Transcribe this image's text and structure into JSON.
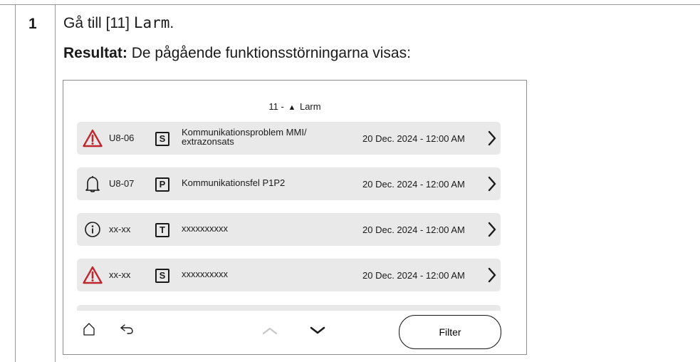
{
  "step": {
    "number": "1",
    "instruction_prefix": "Gå till [11] ",
    "instruction_code": "Larm",
    "instruction_suffix": ".",
    "result_label": "Resultat:",
    "result_text": " De pågående funktionsstörningarna visas:"
  },
  "screen": {
    "title_prefix": "11 - ",
    "title_icon": "warning-triangle-icon",
    "title_text": "Larm",
    "rows": [
      {
        "icon": "warning-triangle-icon",
        "code": "U8-06",
        "badge": "S",
        "desc": "Kommunikationsproblem MMI/ extrazonsats",
        "date": "20 Dec. 2024 - 12:00 AM"
      },
      {
        "icon": "bell-icon",
        "code": "U8-07",
        "badge": "P",
        "desc": "Kommunikationsfel P1P2",
        "date": "20 Dec. 2024 - 12:00 AM"
      },
      {
        "icon": "info-circle-icon",
        "code": "xx-xx",
        "badge": "T",
        "desc": "xxxxxxxxxx",
        "date": "20 Dec. 2024 - 12:00 AM"
      },
      {
        "icon": "warning-triangle-icon",
        "code": "xx-xx",
        "badge": "S",
        "desc": "xxxxxxxxxx",
        "date": "20 Dec. 2024 - 12:00 AM"
      }
    ],
    "filter_label": "Filter",
    "colors": {
      "warning": "#c0272d",
      "row_bg": "#e9e9e9",
      "up_disabled": "#c8c8c8"
    }
  }
}
